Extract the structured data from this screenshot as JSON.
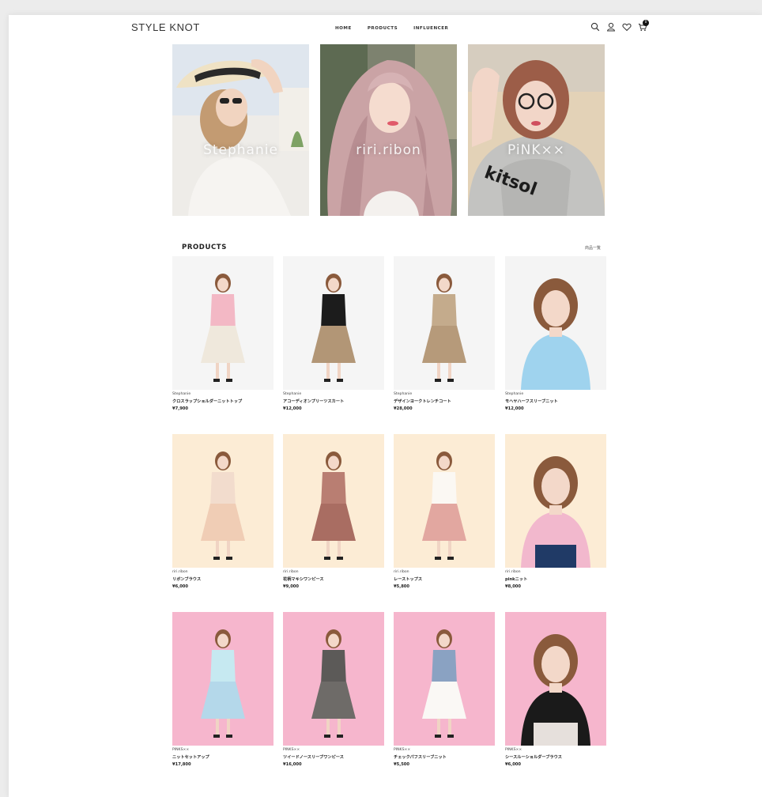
{
  "header": {
    "logo": "STYLE KNOT",
    "nav": [
      "HOME",
      "PRODUCTS",
      "INFLUENCER"
    ],
    "cart_count": "0"
  },
  "influencers": [
    {
      "name": "Stephanie",
      "bg": "#e9e6e1",
      "accent": "#caa27a"
    },
    {
      "name": "riri.ribon",
      "bg": "#8b8a7e",
      "accent": "#d9b3b8"
    },
    {
      "name": "PiNK××",
      "bg": "#dccdb6",
      "accent": "#b97463"
    }
  ],
  "products_section": {
    "title": "PRODUCTS",
    "see_all": "商品一覧"
  },
  "products": [
    {
      "brand": "Stephanie",
      "name": "クロスラップショルダーニットトップ",
      "price": "¥7,900",
      "bg": "#f5f5f5",
      "top": "#f3b8c5",
      "bottom": "#efe8dc"
    },
    {
      "brand": "Stephanie",
      "name": "アコーディオンプリーツスカート",
      "price": "¥12,000",
      "bg": "#f5f5f5",
      "top": "#1c1c1c",
      "bottom": "#b29676"
    },
    {
      "brand": "Stephanie",
      "name": "デザインヨークトレンチコート",
      "price": "¥28,000",
      "bg": "#f5f5f5",
      "top": "#c4ab8c",
      "bottom": "#b69a7a"
    },
    {
      "brand": "Stephanie",
      "name": "モヘヤハーフスリーブニット",
      "price": "¥12,000",
      "bg": "#f4f4f4",
      "top": "#9fd3ee",
      "bottom": "#f4f4f4"
    },
    {
      "brand": "riri.ribon",
      "name": "リボンブラウス",
      "price": "¥6,000",
      "bg": "#fcecd5",
      "top": "#f2dccd",
      "bottom": "#f0cdb5"
    },
    {
      "brand": "riri.ribon",
      "name": "花柄マキシワンピース",
      "price": "¥9,000",
      "bg": "#fcecd5",
      "top": "#b97e72",
      "bottom": "#a96d62"
    },
    {
      "brand": "riri.ribon",
      "name": "レーストップス",
      "price": "¥5,800",
      "bg": "#fcecd5",
      "top": "#fbf8f3",
      "bottom": "#e2a7a0"
    },
    {
      "brand": "riri.ribon",
      "name": "pinkニット",
      "price": "¥8,000",
      "bg": "#fcecd5",
      "top": "#f2b8cd",
      "bottom": "#203a66"
    },
    {
      "brand": "PINKS××",
      "name": "ニットセットアップ",
      "price": "¥17,800",
      "bg": "#f6b6cd",
      "top": "#c6e9f1",
      "bottom": "#b4d8ea"
    },
    {
      "brand": "PINKS××",
      "name": "ツイードノースリーブワンピース",
      "price": "¥16,000",
      "bg": "#f6b6cd",
      "top": "#5c5a58",
      "bottom": "#6e6b68"
    },
    {
      "brand": "PINKS××",
      "name": "チェックパフスリーブニット",
      "price": "¥5,500",
      "bg": "#f6b6cd",
      "top": "#8aa2c2",
      "bottom": "#faf8f5"
    },
    {
      "brand": "PINKS××",
      "name": "シースルーショルダーブラウス",
      "price": "¥6,000",
      "bg": "#f6b6cd",
      "top": "#1a1a1a",
      "bottom": "#e6e0dc"
    }
  ]
}
